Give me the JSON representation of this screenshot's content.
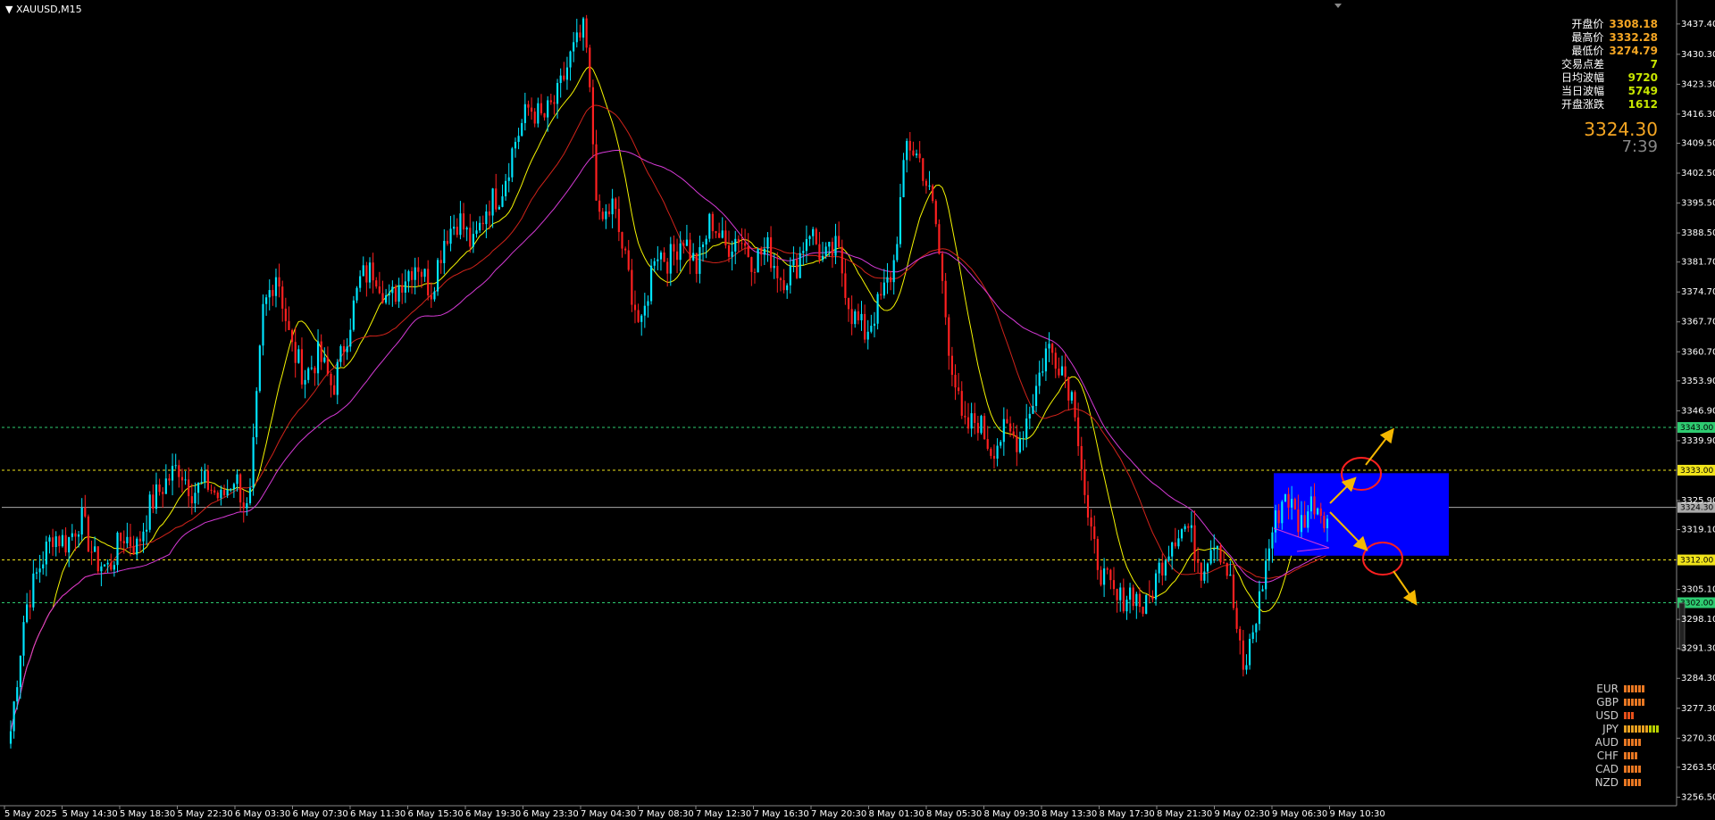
{
  "symbol": "XAUUSD,M15",
  "info_panel": [
    {
      "label": "开盘价",
      "value": "3308.18",
      "color": "#f5a623"
    },
    {
      "label": "最高价",
      "value": "3332.28",
      "color": "#f5a623"
    },
    {
      "label": "最低价",
      "value": "3274.79",
      "color": "#f5a623"
    },
    {
      "label": "交易点差",
      "value": "7",
      "color": "#c8e600"
    },
    {
      "label": "日均波幅",
      "value": "9720",
      "color": "#c8e600"
    },
    {
      "label": "当日波幅",
      "value": "5749",
      "color": "#c8e600"
    },
    {
      "label": "开盘涨跌",
      "value": "1612",
      "color": "#c8e600"
    }
  ],
  "current_price": "3324.30",
  "countdown": "7:39",
  "currency_strength": [
    {
      "name": "EUR",
      "level": 6,
      "color": "#e87722"
    },
    {
      "name": "GBP",
      "level": 6,
      "color": "#e87722"
    },
    {
      "name": "USD",
      "level": 3,
      "color": "#e8501a"
    },
    {
      "name": "JPY",
      "level": 10,
      "color": "#e8a020"
    },
    {
      "name": "AUD",
      "level": 5,
      "color": "#e87722"
    },
    {
      "name": "CHF",
      "level": 4,
      "color": "#e87722"
    },
    {
      "name": "CAD",
      "level": 5,
      "color": "#e87722"
    },
    {
      "name": "NZD",
      "level": 5,
      "color": "#e87722"
    }
  ],
  "chart_data": {
    "type": "candlestick",
    "xlabel": "",
    "ylabel": "",
    "ylim": [
      3254.5,
      3440.5
    ],
    "y_ticks": [
      "3437.40",
      "3430.30",
      "3423.30",
      "3416.30",
      "3409.50",
      "3402.50",
      "3395.50",
      "3388.50",
      "3381.70",
      "3374.70",
      "3367.70",
      "3360.70",
      "3353.90",
      "3346.90",
      "3339.90",
      "3325.90",
      "3319.10",
      "3305.10",
      "3298.10",
      "3291.30",
      "3284.30",
      "3277.30",
      "3270.30",
      "3263.50",
      "3256.50"
    ],
    "x_ticks": [
      "5 May 2025",
      "5 May 14:30",
      "5 May 18:30",
      "5 May 22:30",
      "6 May 03:30",
      "6 May 07:30",
      "6 May 11:30",
      "6 May 15:30",
      "6 May 19:30",
      "6 May 23:30",
      "7 May 04:30",
      "7 May 08:30",
      "7 May 12:30",
      "7 May 16:30",
      "7 May 20:30",
      "8 May 01:30",
      "8 May 05:30",
      "8 May 09:30",
      "8 May 13:30",
      "8 May 17:30",
      "8 May 21:30",
      "9 May 02:30",
      "9 May 06:30",
      "9 May 10:30"
    ],
    "price_path": [
      3272,
      3300,
      3310,
      3318,
      3316,
      3322,
      3312,
      3310,
      3318,
      3315,
      3325,
      3330,
      3334,
      3328,
      3330,
      3326,
      3332,
      3322,
      3370,
      3380,
      3362,
      3355,
      3360,
      3352,
      3365,
      3378,
      3380,
      3372,
      3378,
      3382,
      3375,
      3388,
      3392,
      3385,
      3395,
      3398,
      3410,
      3418,
      3415,
      3420,
      3430,
      3436,
      3390,
      3395,
      3380,
      3365,
      3385,
      3382,
      3388,
      3380,
      3392,
      3385,
      3388,
      3382,
      3385,
      3378,
      3380,
      3390,
      3382,
      3385,
      3370,
      3365,
      3372,
      3380,
      3410,
      3405,
      3392,
      3362,
      3342,
      3345,
      3338,
      3342,
      3340,
      3350,
      3362,
      3358,
      3348,
      3318,
      3308,
      3302,
      3305,
      3300,
      3310,
      3318,
      3320,
      3310,
      3318,
      3308,
      3285,
      3300,
      3318,
      3328,
      3320,
      3326,
      3322
    ],
    "horizontal_lines": [
      {
        "price": 3343.0,
        "label": "3343.00",
        "color": "#2ecc71",
        "style": "dotted"
      },
      {
        "price": 3333.0,
        "label": "3333.00",
        "color": "#f1e41a",
        "style": "dotted"
      },
      {
        "price": 3324.3,
        "label": "3324.30",
        "color": "#aaaaaa",
        "style": "solid"
      },
      {
        "price": 3312.0,
        "label": "3312.00",
        "color": "#f1e41a",
        "style": "dotted"
      },
      {
        "price": 3302.0,
        "label": "3302.00",
        "color": "#2ecc71",
        "style": "dotted"
      }
    ],
    "moving_averages": [
      {
        "color": "#f5f500"
      },
      {
        "color": "#d0231a"
      },
      {
        "color": "#d63ad6"
      }
    ],
    "range_box": {
      "price_top": 3332.3,
      "price_bottom": 3313.0,
      "color": "#0000ff"
    }
  }
}
